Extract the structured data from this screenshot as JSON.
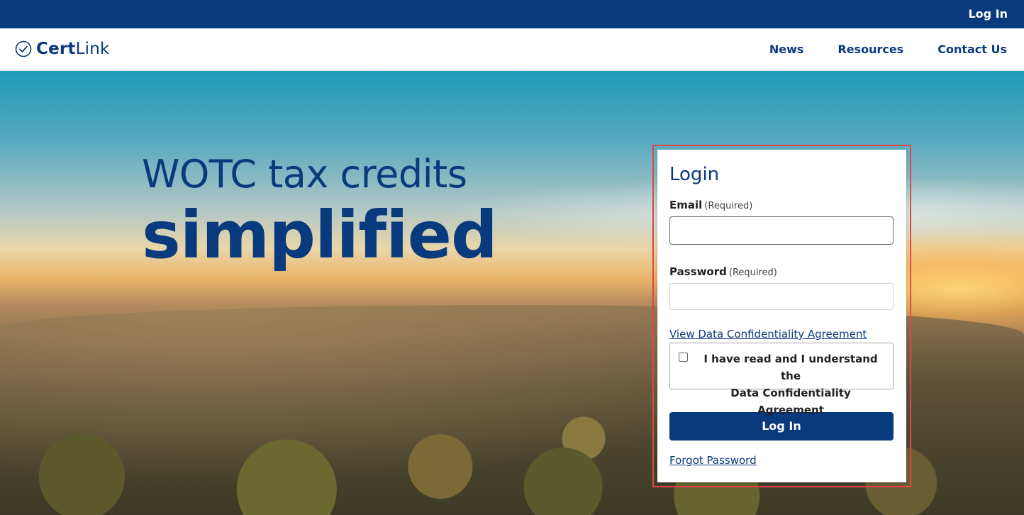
{
  "topbar": {
    "login_label": "Log In"
  },
  "brand": {
    "name_bold": "Cert",
    "name_regular": "Link",
    "logo_icon": "check-circle-icon"
  },
  "nav": {
    "items": [
      {
        "label": "News"
      },
      {
        "label": "Resources"
      },
      {
        "label": "Contact Us"
      }
    ]
  },
  "hero": {
    "headline_line1": "WOTC tax credits",
    "headline_line2": "simplified"
  },
  "login": {
    "title": "Login",
    "email_label": "Email",
    "email_required": "(Required)",
    "email_value": "",
    "password_label": "Password",
    "password_required": "(Required)",
    "password_value": "",
    "dca_link": "View Data Confidentiality Agreement",
    "agree_text_line1": "I have read and I understand the",
    "agree_text_line2": "Data Confidentiality Agreement",
    "agree_checked": false,
    "button_label": "Log In",
    "forgot_link": "Forgot Password"
  },
  "colors": {
    "brand_blue": "#0a3a7e",
    "highlight_red": "#e0454a"
  }
}
